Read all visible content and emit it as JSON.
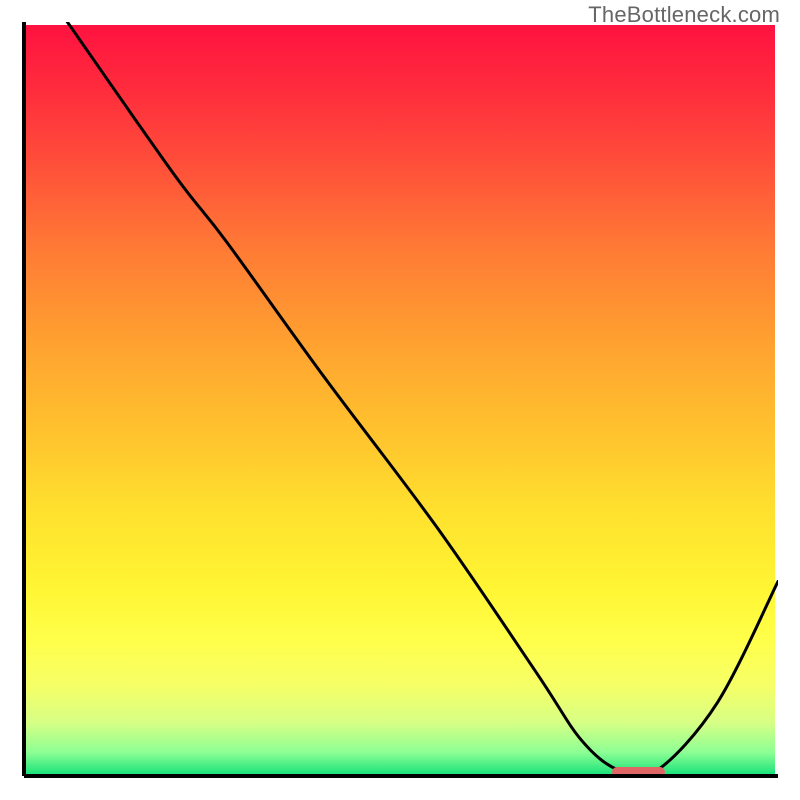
{
  "watermark": "TheBottleneck.com",
  "colors": {
    "axis": "#000000",
    "curve": "#000000",
    "marker": "#e06666",
    "gradient_top": "#ff1240",
    "gradient_bottom": "#17e27a"
  },
  "chart_data": {
    "type": "line",
    "title": "",
    "xlabel": "",
    "ylabel": "",
    "xlim": [
      0,
      100
    ],
    "ylim": [
      0,
      100
    ],
    "series": [
      {
        "name": "curve",
        "x": [
          6,
          20,
          27,
          40,
          55,
          68,
          74,
          79,
          84,
          92,
          100
        ],
        "values": [
          100,
          80,
          71,
          53,
          33,
          14,
          5,
          1,
          1,
          10,
          26
        ]
      }
    ],
    "annotations": [
      {
        "kind": "hmarker",
        "x_start": 78,
        "x_end": 85,
        "y": 0.5
      }
    ]
  }
}
